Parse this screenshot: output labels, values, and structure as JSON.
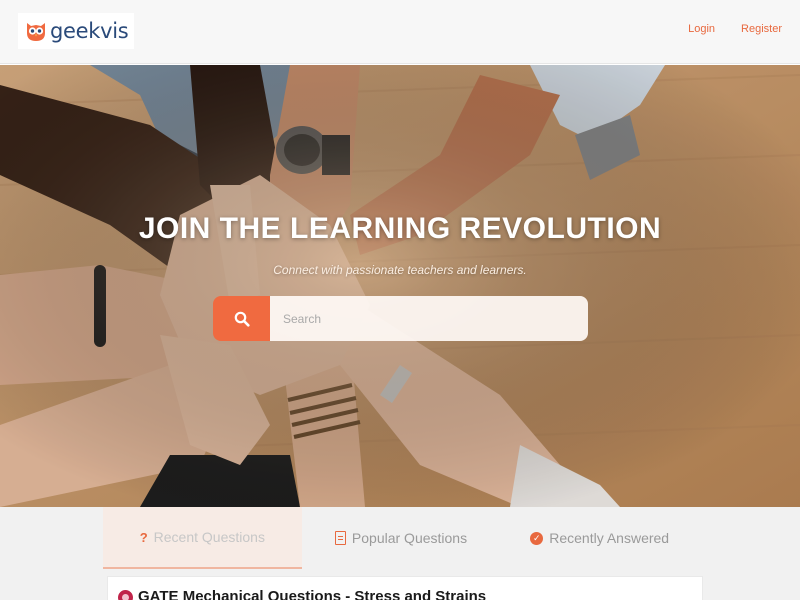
{
  "brand": {
    "name": "geekvis"
  },
  "header": {
    "nav": {
      "login": "Login",
      "register": "Register"
    }
  },
  "hero": {
    "title": "JOIN THE LEARNING REVOLUTION",
    "subtitle": "Connect with passionate teachers and learners.",
    "search": {
      "placeholder": "Search",
      "value": ""
    }
  },
  "tabs": [
    {
      "label": "Recent Questions",
      "icon": "question-icon",
      "active": true
    },
    {
      "label": "Popular Questions",
      "icon": "document-icon",
      "active": false
    },
    {
      "label": "Recently Answered",
      "icon": "check-circle-icon",
      "active": false
    }
  ],
  "questions": [
    {
      "title": "GATE Mechanical Questions - Stress and Strains"
    }
  ],
  "colors": {
    "accent": "#f06a40",
    "brand_text": "#2a4a7a",
    "link": "#e8693f"
  }
}
